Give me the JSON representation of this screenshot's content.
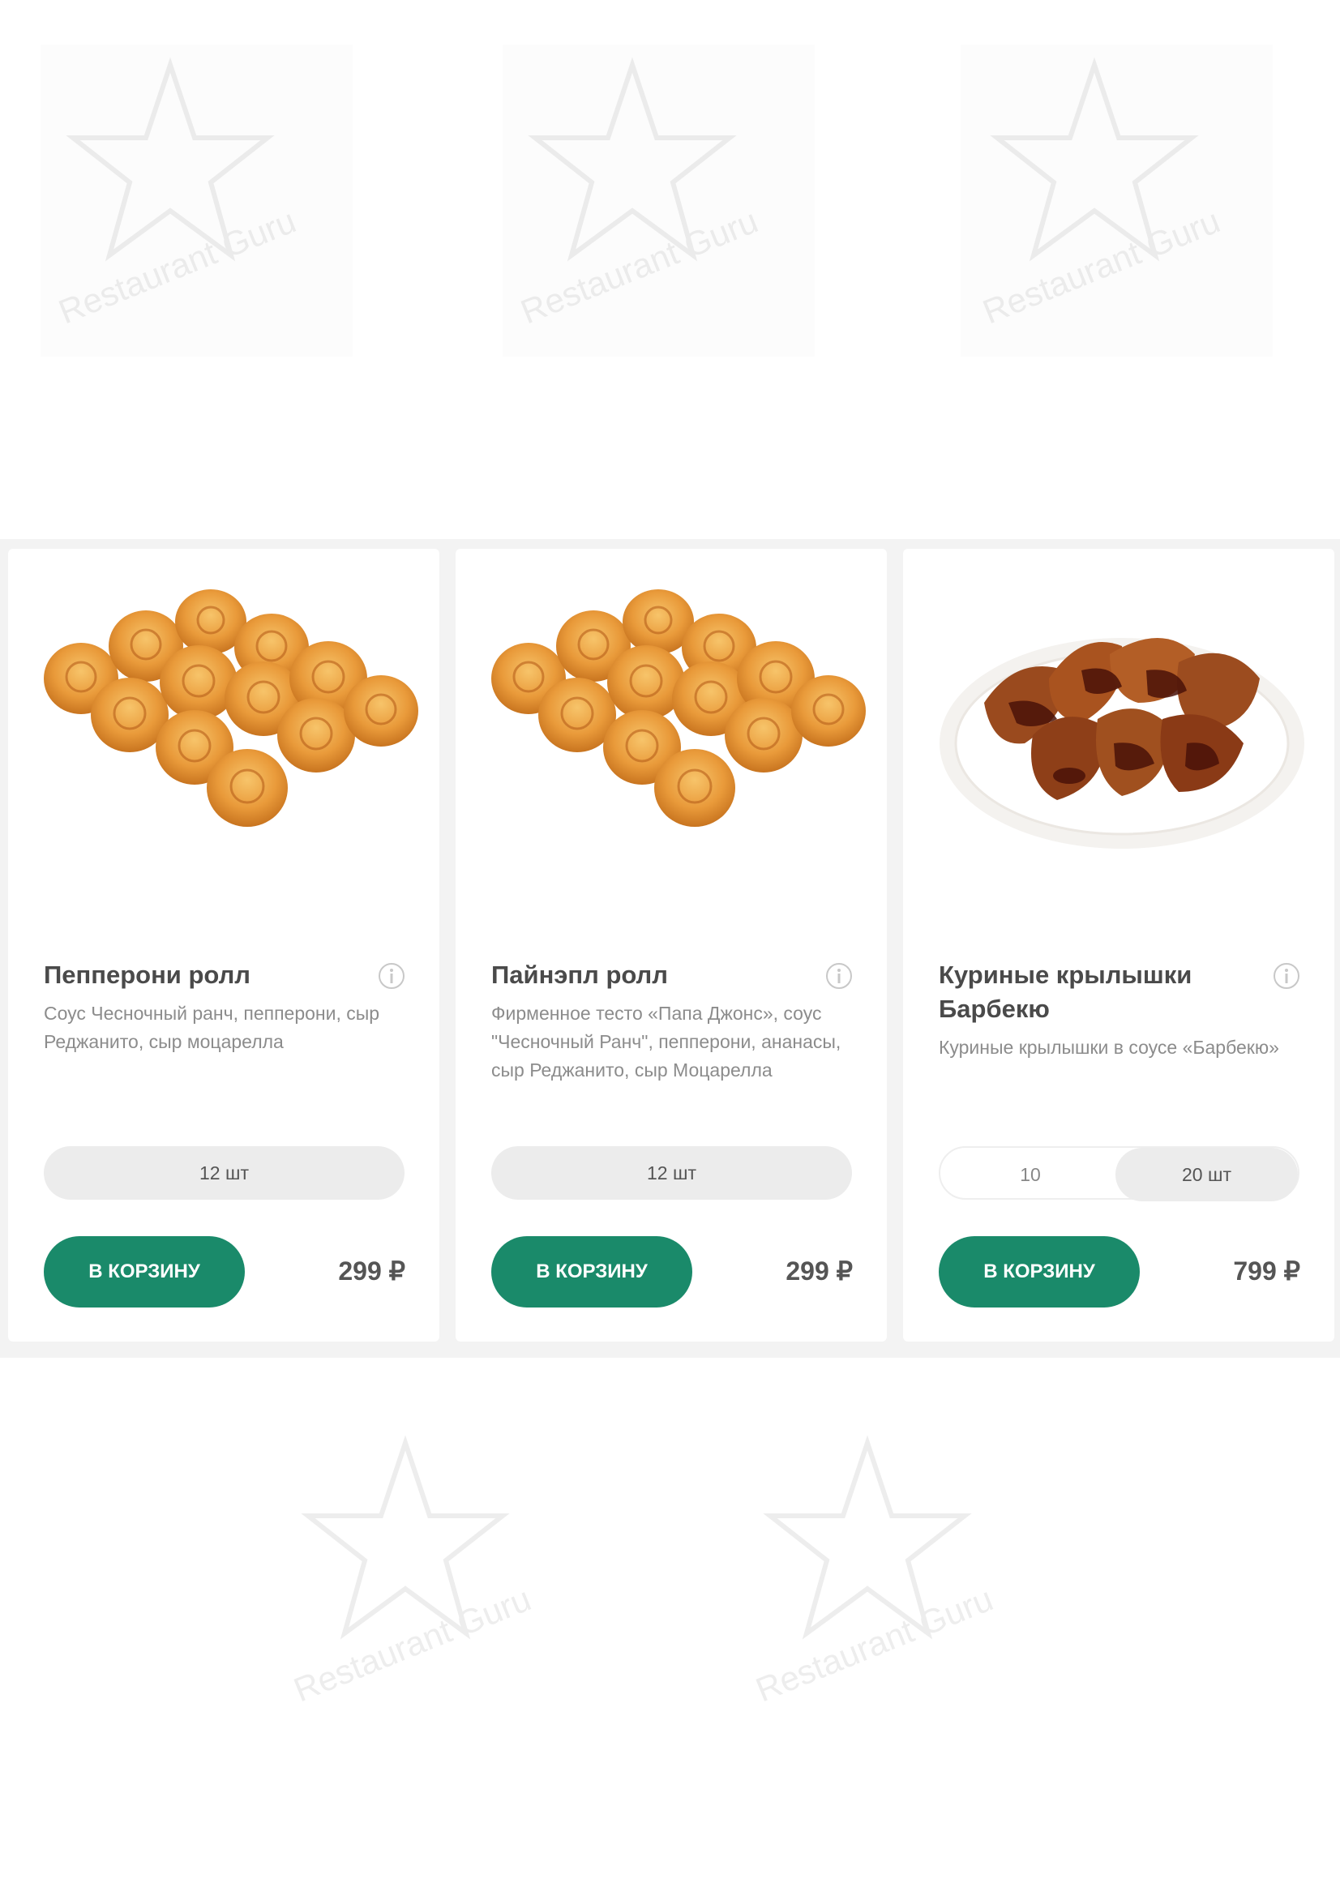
{
  "watermark": {
    "brand": "Restaurant Guru"
  },
  "products": [
    {
      "title": "Пепперони ролл",
      "description": "Соус Чесночный ранч, пепперони, сыр Реджанито, сыр моцарелла",
      "sizes": [
        "12 шт"
      ],
      "button_label": "В КОРЗИНУ",
      "price": "299 ₽",
      "image": "rolls-photo"
    },
    {
      "title": "Пайнэпл ролл",
      "description": "Фирменное тесто «Папа Джонс», соус \"Чесночный Ранч\", пепперони, ананасы, сыр Реджанито, сыр Моцарелла",
      "sizes": [
        "12 шт"
      ],
      "button_label": "В КОРЗИНУ",
      "price": "299 ₽",
      "image": "rolls-photo"
    },
    {
      "title": "Куриные крылышки Барбекю",
      "description": "Куриные крылышки в соусе «Барбекю»",
      "sizes": [
        "10",
        "20 шт"
      ],
      "selected_size": "20 шт",
      "button_label": "В КОРЗИНУ",
      "price": "799 ₽",
      "image": "wings-photo"
    }
  ],
  "colors": {
    "accent": "#1a8a6a",
    "title": "#4a4a4a",
    "description": "#8c8c8c",
    "strip_background": "#f3f3f3",
    "pill_background": "#ececec"
  }
}
